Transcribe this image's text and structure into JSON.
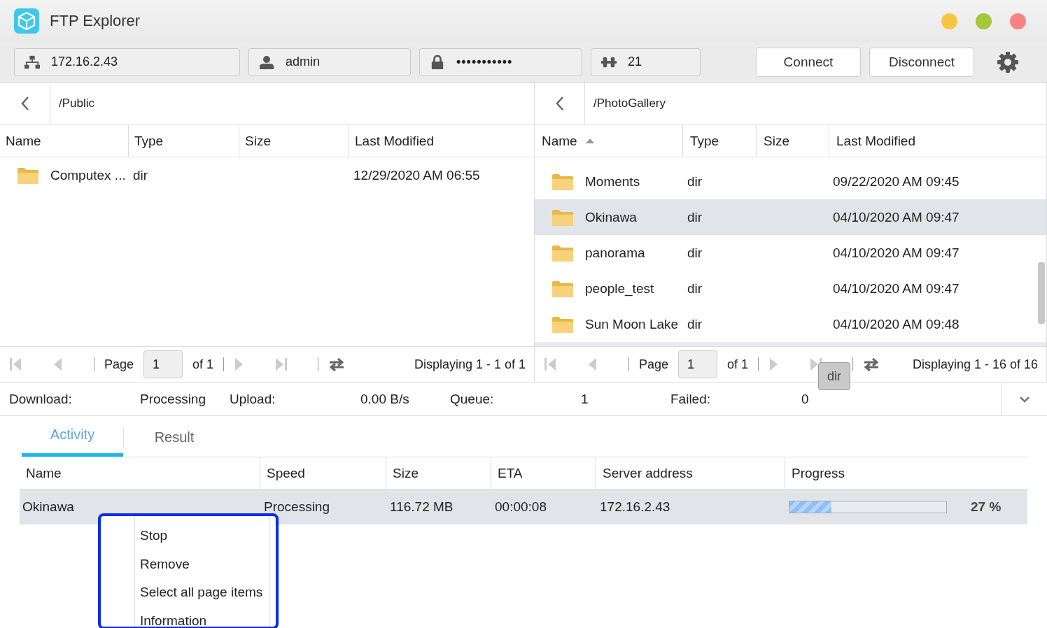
{
  "window": {
    "title": "FTP Explorer"
  },
  "connection": {
    "host": "172.16.2.43",
    "user": "admin",
    "password": "•••••••••••",
    "port": "21",
    "buttons": [
      "Connect",
      "Disconnect"
    ]
  },
  "panes": [
    {
      "path": "/Public",
      "columns": [
        {
          "label": "Name",
          "sorted": false
        },
        {
          "label": "Type",
          "sorted": false
        },
        {
          "label": "Size",
          "sorted": false
        },
        {
          "label": "Last Modified",
          "sorted": false
        }
      ],
      "rows": [
        {
          "name": "Computex ...",
          "type": "dir",
          "size": "",
          "modified": "12/29/2020 AM 06:55",
          "selected": false
        }
      ],
      "pager": {
        "page_label": "Page",
        "page": "1",
        "of": "of 1",
        "display": "Displaying 1 - 1 of 1"
      }
    },
    {
      "path": "/PhotoGallery",
      "columns": [
        {
          "label": "Name",
          "sorted": true
        },
        {
          "label": "Type",
          "sorted": false
        },
        {
          "label": "Size",
          "sorted": false
        },
        {
          "label": "Last Modified",
          "sorted": false
        }
      ],
      "rows": [
        {
          "name": "Moments",
          "type": "dir",
          "size": "",
          "modified": "09/22/2020 AM 09:45",
          "selected": false
        },
        {
          "name": "Okinawa",
          "type": "dir",
          "size": "",
          "modified": "04/10/2020 AM 09:47",
          "selected": true
        },
        {
          "name": "panorama",
          "type": "dir",
          "size": "",
          "modified": "04/10/2020 AM 09:47",
          "selected": false
        },
        {
          "name": "people_test",
          "type": "dir",
          "size": "",
          "modified": "04/10/2020 AM 09:47",
          "selected": false
        },
        {
          "name": "Sun Moon Lake",
          "type": "dir",
          "size": "",
          "modified": "04/10/2020 AM 09:48",
          "selected": false
        }
      ],
      "pager": {
        "page_label": "Page",
        "page": "1",
        "of": "of 1",
        "display": "Displaying 1 - 16 of 16"
      },
      "tooltip": "dir"
    }
  ],
  "status": [
    {
      "label": "Download:",
      "value": "Processing"
    },
    {
      "label": "Upload:",
      "value": "0.00 B/s"
    },
    {
      "label": "Queue:",
      "value": "1"
    },
    {
      "label": "Failed:",
      "value": "0"
    }
  ],
  "tabs": [
    {
      "label": "Activity",
      "selected": true
    },
    {
      "label": "Result",
      "selected": false
    }
  ],
  "transfers": {
    "columns": [
      "Name",
      "Speed",
      "Size",
      "ETA",
      "Server address",
      "Progress"
    ],
    "rows": [
      {
        "name": "Okinawa",
        "speed": "Processing",
        "size": "116.72 MB",
        "eta": "00:00:08",
        "server": "172.16.2.43",
        "level": 0.27,
        "percent": "27 %",
        "selected": true
      }
    ]
  },
  "context_menu": [
    "Stop",
    "Remove",
    "Select all page items",
    "Information"
  ]
}
